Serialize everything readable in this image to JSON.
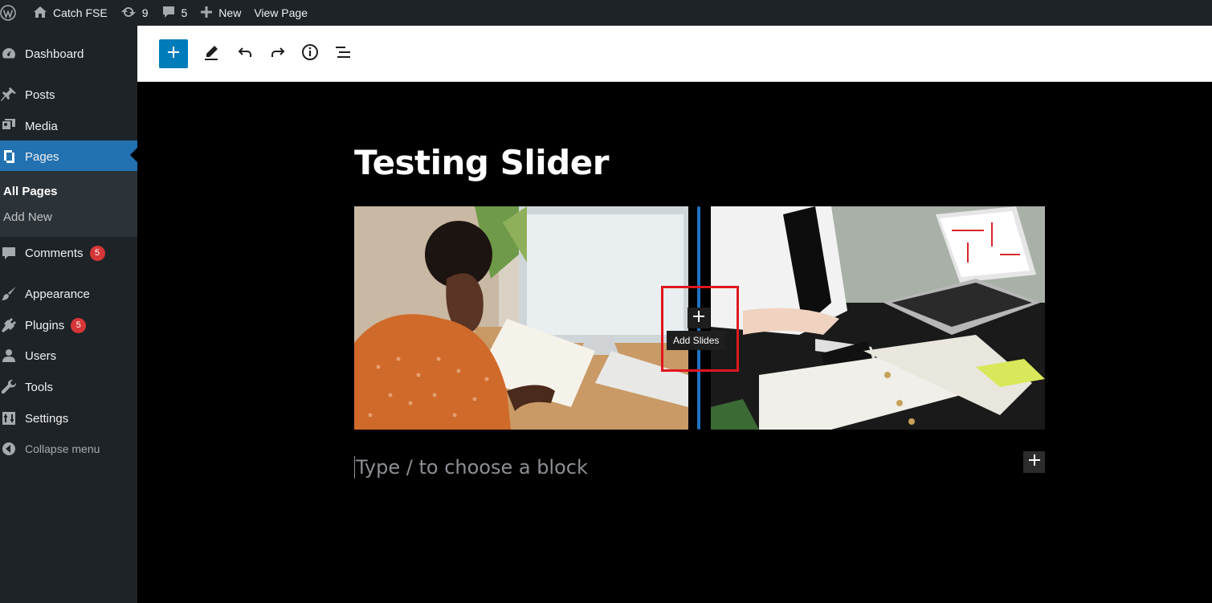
{
  "adminbar": {
    "site_name": "Catch FSE",
    "updates_count": "9",
    "comments_count": "5",
    "new_label": "New",
    "view_page_label": "View Page"
  },
  "sidebar": {
    "items": [
      {
        "label": "Dashboard",
        "icon": "dashboard-icon"
      },
      {
        "label": "Posts",
        "icon": "pin-icon"
      },
      {
        "label": "Media",
        "icon": "media-icon"
      },
      {
        "label": "Pages",
        "icon": "pages-icon"
      },
      {
        "label": "Comments",
        "icon": "comment-icon",
        "badge": "5"
      },
      {
        "label": "Appearance",
        "icon": "brush-icon"
      },
      {
        "label": "Plugins",
        "icon": "plugin-icon",
        "badge": "5"
      },
      {
        "label": "Users",
        "icon": "user-icon"
      },
      {
        "label": "Tools",
        "icon": "wrench-icon"
      },
      {
        "label": "Settings",
        "icon": "settings-icon"
      }
    ],
    "submenu": [
      "All Pages",
      "Add New"
    ],
    "collapse_label": "Collapse menu"
  },
  "editor": {
    "page_title": "Testing Slider",
    "tooltip": "Add Slides",
    "placeholder": "Type / to choose a block"
  },
  "colors": {
    "accent": "#2271b1",
    "primary_button": "#007cba",
    "highlight": "#e0161f",
    "badge": "#d63638"
  }
}
